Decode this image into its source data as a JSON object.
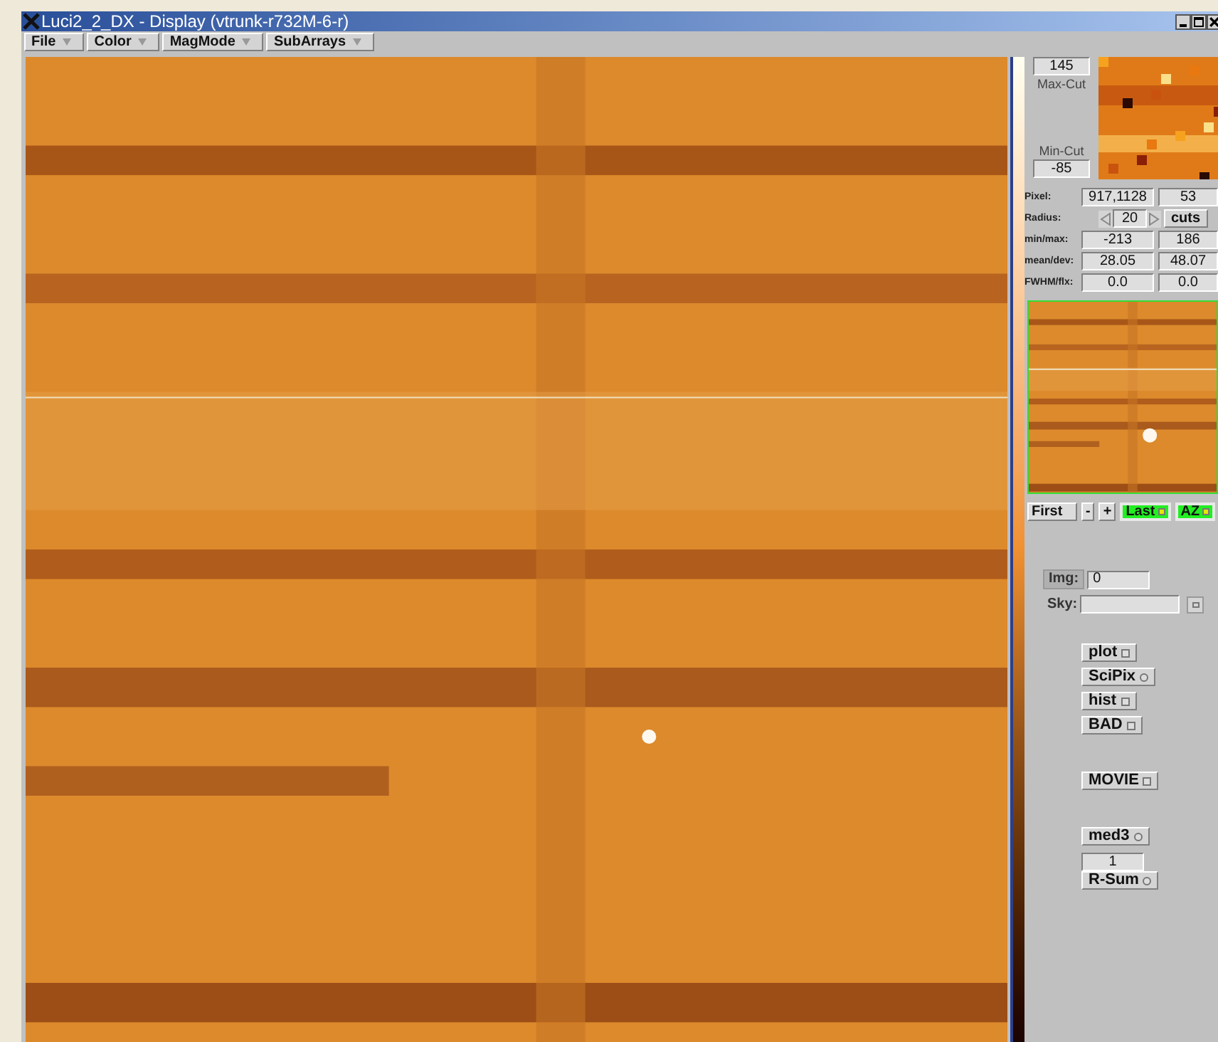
{
  "window": {
    "title": "Luci2_2_DX - Display (vtrunk-r732M-6-r)"
  },
  "menu": [
    {
      "label": "File"
    },
    {
      "label": "Color"
    },
    {
      "label": "MagMode"
    },
    {
      "label": "SubArrays"
    }
  ],
  "cuts": {
    "max_value": "145",
    "max_label": "Max-Cut",
    "min_label": "Min-Cut",
    "min_value": "-85"
  },
  "stats": [
    {
      "kind": "pair",
      "label": "Pixel:",
      "values": [
        "917,1128",
        "53"
      ]
    },
    {
      "kind": "radius",
      "label": "Radius:",
      "value": "20",
      "button": "cuts"
    },
    {
      "kind": "pair",
      "label": "min/max:",
      "values": [
        "-213",
        "186"
      ]
    },
    {
      "kind": "pair",
      "label": "mean/dev:",
      "values": [
        "28.05",
        "48.07"
      ]
    },
    {
      "kind": "pair",
      "label": "FWHM/flx:",
      "values": [
        "0.0",
        "0.0"
      ]
    }
  ],
  "frames": [
    {
      "label": "First",
      "on": false,
      "indicator": false
    },
    {
      "label": "-",
      "on": false,
      "indicator": false
    },
    {
      "label": "+",
      "on": false,
      "indicator": false
    },
    {
      "label": "Last",
      "on": true,
      "indicator": true
    },
    {
      "label": "AZ",
      "on": true,
      "indicator": true
    }
  ],
  "img": {
    "label": "Img:",
    "value": "0"
  },
  "sky": {
    "label": "Sky:"
  },
  "tools": [
    {
      "kind": "toggle",
      "label": "plot"
    },
    {
      "kind": "radio",
      "label": "SciPix"
    },
    {
      "kind": "toggle",
      "label": "hist"
    },
    {
      "kind": "toggle",
      "label": "BAD"
    },
    {
      "kind": "gap"
    },
    {
      "kind": "toggle",
      "label": "MOVIE"
    },
    {
      "kind": "gap"
    },
    {
      "kind": "radio",
      "label": "med3"
    },
    {
      "kind": "field",
      "value": "1"
    },
    {
      "kind": "radio",
      "label": "R-Sum"
    }
  ]
}
